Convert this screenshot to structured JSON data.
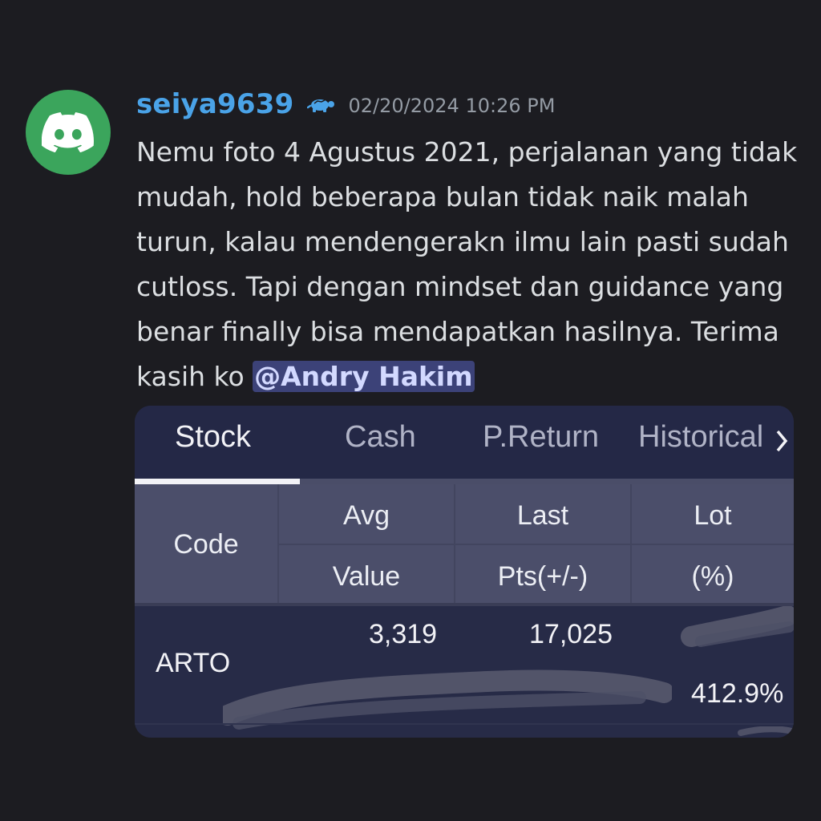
{
  "user": {
    "username": "seiya9639",
    "role_icon": "turtle-icon",
    "timestamp": "02/20/2024 10:26 PM",
    "avatar_icon": "discord-logo-icon",
    "avatar_color": "#3ba55c"
  },
  "message": {
    "text": "Nemu foto 4 Agustus 2021, perjalanan yang tidak mudah, hold beberapa bulan tidak naik malah turun, kalau mendengerakn ilmu lain pasti sudah cutloss. Tapi dengan mindset dan guidance yang benar finally bisa mendapatkan hasilnya. Terima kasih ko ",
    "mention": "@Andry Hakim"
  },
  "attachment": {
    "tabs": [
      {
        "label": "Stock",
        "active": true
      },
      {
        "label": "Cash",
        "active": false
      },
      {
        "label": "P.Return",
        "active": false
      },
      {
        "label": "Historical",
        "active": false
      }
    ],
    "more_icon": "chevron-right-icon",
    "table": {
      "headers": {
        "code": "Code",
        "avg": "Avg",
        "value": "Value",
        "last": "Last",
        "pts": "Pts(+/-)",
        "lot": "Lot",
        "pct": "(%)"
      },
      "rows": [
        {
          "code": "ARTO",
          "avg": "3,319",
          "last": "17,025",
          "pct": "412.9%"
        }
      ]
    }
  },
  "colors": {
    "background": "#1c1c21",
    "username": "#4aa3e8",
    "mention_bg": "#3c4278",
    "tabbar": "#242846",
    "table_header": "#4b4e6a"
  }
}
